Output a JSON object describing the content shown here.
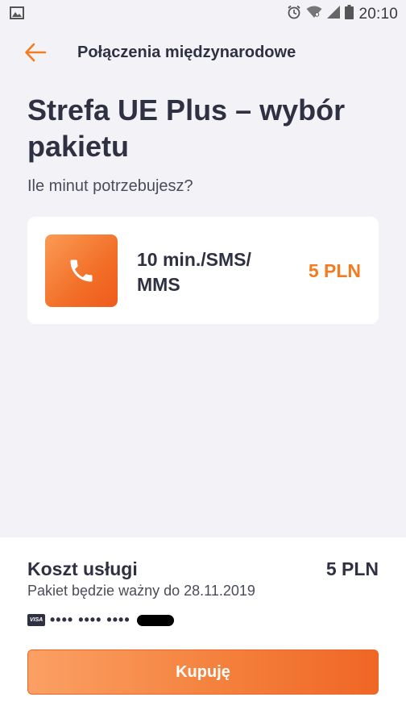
{
  "status_bar": {
    "time": "20:10",
    "icons": [
      "image-notification-icon",
      "alarm-icon",
      "wifi-icon",
      "signal-icon",
      "battery-icon"
    ]
  },
  "header": {
    "title": "Połączenia międzynarodowe",
    "back_icon": "arrow-left-icon"
  },
  "page": {
    "title": "Strefa UE Plus – wybór pakietu",
    "question": "Ile minut potrzebujesz?"
  },
  "package": {
    "icon": "phone-icon",
    "name": "10 min./SMS/ MMS",
    "price": "5 PLN"
  },
  "summary": {
    "cost_label": "Koszt usługi",
    "cost_value": "5 PLN",
    "validity": "Pakiet będzie ważny do 28.11.2019",
    "card_brand": "VISA",
    "card_mask": "•••• •••• ••••"
  },
  "actions": {
    "buy_label": "Kupuję"
  },
  "colors": {
    "accent": "#f47c20",
    "background": "#f3f3f7",
    "text": "#2f3142"
  }
}
